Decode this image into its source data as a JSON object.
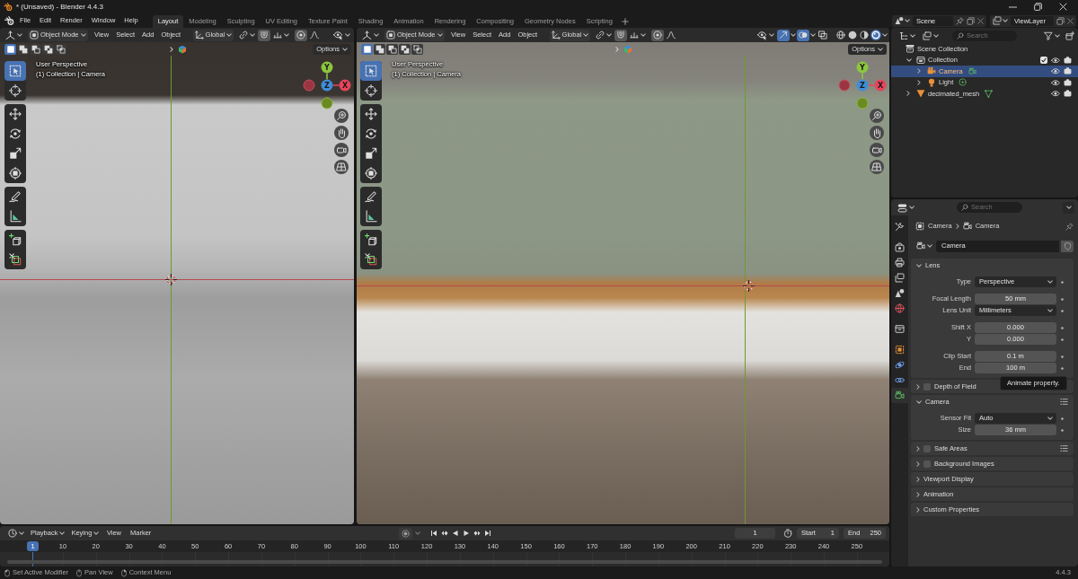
{
  "window": {
    "title": "* (Unsaved) - Blender 4.4.3"
  },
  "menu": [
    "File",
    "Edit",
    "Render",
    "Window",
    "Help"
  ],
  "workspaces": [
    {
      "label": "Layout",
      "selected": true
    },
    {
      "label": "Modeling",
      "selected": false
    },
    {
      "label": "Sculpting",
      "selected": false
    },
    {
      "label": "UV Editing",
      "selected": false
    },
    {
      "label": "Texture Paint",
      "selected": false
    },
    {
      "label": "Shading",
      "selected": false
    },
    {
      "label": "Animation",
      "selected": false
    },
    {
      "label": "Rendering",
      "selected": false
    },
    {
      "label": "Compositing",
      "selected": false
    },
    {
      "label": "Geometry Nodes",
      "selected": false
    },
    {
      "label": "Scripting",
      "selected": false
    }
  ],
  "scene": {
    "name": "Scene"
  },
  "view_layer": {
    "name": "ViewLayer"
  },
  "viewports": [
    {
      "kind": "mesh",
      "mode": "Object Mode",
      "menus": [
        "View",
        "Select",
        "Add",
        "Object"
      ],
      "orientation": "Global",
      "snap": true,
      "proportional_editing": true,
      "select_modes": [
        {
          "selected": true
        },
        {
          "selected": false
        },
        {
          "selected": false
        },
        {
          "selected": false
        },
        {
          "selected": false
        }
      ],
      "options": "Options",
      "view_name": "User Perspective",
      "context": "(1) Collection | Camera",
      "gizmo_axes": [
        "Y",
        "Z",
        "X"
      ],
      "tools": [
        {
          "items": [
            {
              "selected": true
            },
            {
              "selected": false
            }
          ]
        },
        {
          "items": [
            {
              "selected": false
            },
            {
              "selected": false
            },
            {
              "selected": false
            },
            {
              "selected": false
            }
          ]
        },
        {
          "items": [
            {
              "selected": false
            },
            {
              "selected": false
            }
          ]
        },
        {
          "items": [
            {
              "selected": false
            },
            {
              "selected": false
            }
          ]
        }
      ]
    },
    {
      "kind": "textured",
      "mode": "Object Mode",
      "menus": [
        "View",
        "Select",
        "Add",
        "Object"
      ],
      "orientation": "Global",
      "snap": true,
      "proportional_editing": true,
      "gizmos": true,
      "overlays": true,
      "xray": false,
      "shading_modes": [
        {
          "selected": false
        },
        {
          "selected": false
        },
        {
          "selected": false
        },
        {
          "selected": true
        }
      ],
      "select_modes": [
        {
          "selected": true
        },
        {
          "selected": false
        },
        {
          "selected": false
        },
        {
          "selected": false
        },
        {
          "selected": false
        }
      ],
      "options": "Options",
      "view_name": "User Perspective",
      "context": "(1) Collection | Camera",
      "gizmo_axes": [
        "Y",
        "Z",
        "X"
      ],
      "tools": [
        {
          "items": [
            {
              "selected": true
            },
            {
              "selected": false
            }
          ]
        },
        {
          "items": [
            {
              "selected": false
            },
            {
              "selected": false
            },
            {
              "selected": false
            },
            {
              "selected": false
            }
          ]
        },
        {
          "items": [
            {
              "selected": false
            },
            {
              "selected": false
            }
          ]
        },
        {
          "items": [
            {
              "selected": false
            },
            {
              "selected": false
            }
          ]
        }
      ]
    }
  ],
  "outliner": {
    "search_placeholder": "Search",
    "items": [
      {
        "name": "Scene Collection",
        "kind": "scene_collection",
        "selected": false,
        "children": [
          {
            "name": "Collection",
            "kind": "collection",
            "selected": false,
            "expanded": true,
            "checked": true,
            "visible": true,
            "children": [
              {
                "name": "Camera",
                "kind": "camera",
                "selected": true,
                "expanded": false,
                "visible": true
              },
              {
                "name": "Light",
                "kind": "light",
                "selected": false,
                "expanded": false,
                "visible": true
              }
            ]
          },
          {
            "name": "decimated_mesh",
            "kind": "mesh",
            "selected": false,
            "expanded": false,
            "visible": true
          }
        ]
      }
    ]
  },
  "properties": {
    "search_placeholder": "Search",
    "tab_groups": [
      {
        "tabs": [
          {
            "selected": false
          }
        ]
      },
      {
        "tabs": [
          {
            "selected": false
          },
          {
            "selected": false
          },
          {
            "selected": false
          },
          {
            "selected": false
          },
          {
            "selected": false
          }
        ]
      },
      {
        "tabs": [
          {
            "selected": false
          }
        ]
      },
      {
        "tabs": [
          {
            "selected": false
          },
          {
            "selected": false
          },
          {
            "selected": false
          },
          {
            "selected": true
          }
        ]
      }
    ],
    "breadcrumb": [
      "Camera",
      "Camera"
    ],
    "datablock": "Camera",
    "panels": [
      {
        "title": "Lens",
        "expanded": true,
        "groups": [
          {
            "fields": [
              {
                "label": "Type",
                "value": "Perspective",
                "kind": "dropdown"
              }
            ]
          },
          {
            "fields": [
              {
                "label": "Focal Length",
                "value": "50 mm",
                "kind": "number"
              },
              {
                "label": "Lens Unit",
                "value": "Millimeters",
                "kind": "dropdown"
              }
            ]
          },
          {
            "fields": [
              {
                "label": "Shift X",
                "value": "0.000",
                "kind": "number"
              },
              {
                "label": "Y",
                "value": "0.000",
                "kind": "number"
              }
            ]
          },
          {
            "fields": [
              {
                "label": "Clip Start",
                "value": "0.1 m",
                "kind": "number"
              },
              {
                "label": "End",
                "value": "100 m",
                "kind": "number"
              }
            ]
          }
        ]
      },
      {
        "title": "Depth of Field",
        "expanded": false,
        "checked": false
      },
      {
        "title": "Camera",
        "expanded": true,
        "presets": true,
        "groups": [
          {
            "fields": [
              {
                "label": "Sensor Fit",
                "value": "Auto",
                "kind": "dropdown"
              },
              {
                "label": "Size",
                "value": "36 mm",
                "kind": "number"
              }
            ]
          }
        ]
      },
      {
        "title": "Safe Areas",
        "expanded": false,
        "checked": false,
        "presets": true
      },
      {
        "title": "Background Images",
        "expanded": false,
        "checked": false
      },
      {
        "title": "Viewport Display",
        "expanded": false
      },
      {
        "title": "Animation",
        "expanded": false
      },
      {
        "title": "Custom Properties",
        "expanded": false
      }
    ],
    "tooltip": "Animate property."
  },
  "timeline": {
    "menus": [
      {
        "label": "Playback",
        "kind": "dropdown"
      },
      {
        "label": "Keying",
        "kind": "dropdown"
      },
      {
        "label": "View",
        "kind": "menu"
      },
      {
        "label": "Marker",
        "kind": "menu"
      }
    ],
    "auto_keying": false,
    "current_frame": "1",
    "start_label": "Start",
    "start": "1",
    "end_label": "End",
    "end": "250",
    "playhead": "1",
    "ruler": [
      "10",
      "20",
      "30",
      "40",
      "50",
      "60",
      "70",
      "80",
      "90",
      "100",
      "110",
      "120",
      "130",
      "140",
      "150",
      "160",
      "170",
      "180",
      "190",
      "200",
      "210",
      "220",
      "230",
      "240",
      "250"
    ]
  },
  "status_bar": {
    "hints": [
      "Set Active Modifier",
      "Pan View",
      "Context Menu"
    ],
    "version": "4.4.3"
  }
}
